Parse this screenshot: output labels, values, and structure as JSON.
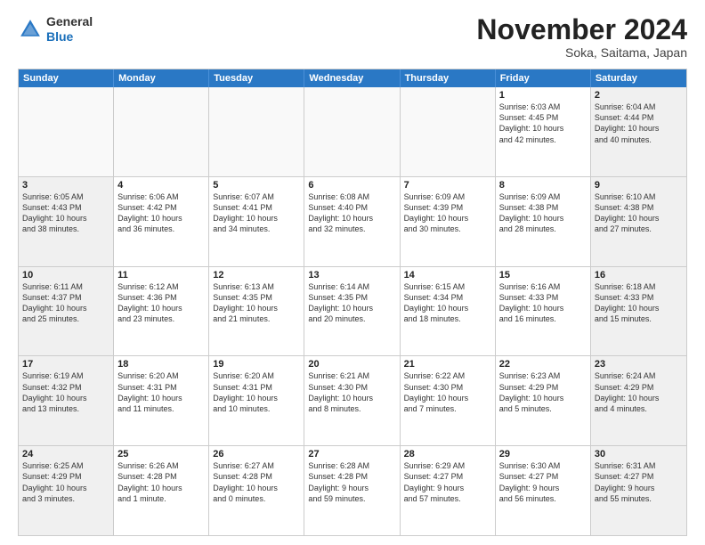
{
  "header": {
    "logo_general": "General",
    "logo_blue": "Blue",
    "month_title": "November 2024",
    "location": "Soka, Saitama, Japan"
  },
  "weekdays": [
    "Sunday",
    "Monday",
    "Tuesday",
    "Wednesday",
    "Thursday",
    "Friday",
    "Saturday"
  ],
  "rows": [
    [
      {
        "day": "",
        "info": "",
        "empty": true
      },
      {
        "day": "",
        "info": "",
        "empty": true
      },
      {
        "day": "",
        "info": "",
        "empty": true
      },
      {
        "day": "",
        "info": "",
        "empty": true
      },
      {
        "day": "",
        "info": "",
        "empty": true
      },
      {
        "day": "1",
        "info": "Sunrise: 6:03 AM\nSunset: 4:45 PM\nDaylight: 10 hours\nand 42 minutes.",
        "empty": false
      },
      {
        "day": "2",
        "info": "Sunrise: 6:04 AM\nSunset: 4:44 PM\nDaylight: 10 hours\nand 40 minutes.",
        "empty": false
      }
    ],
    [
      {
        "day": "3",
        "info": "Sunrise: 6:05 AM\nSunset: 4:43 PM\nDaylight: 10 hours\nand 38 minutes.",
        "empty": false
      },
      {
        "day": "4",
        "info": "Sunrise: 6:06 AM\nSunset: 4:42 PM\nDaylight: 10 hours\nand 36 minutes.",
        "empty": false
      },
      {
        "day": "5",
        "info": "Sunrise: 6:07 AM\nSunset: 4:41 PM\nDaylight: 10 hours\nand 34 minutes.",
        "empty": false
      },
      {
        "day": "6",
        "info": "Sunrise: 6:08 AM\nSunset: 4:40 PM\nDaylight: 10 hours\nand 32 minutes.",
        "empty": false
      },
      {
        "day": "7",
        "info": "Sunrise: 6:09 AM\nSunset: 4:39 PM\nDaylight: 10 hours\nand 30 minutes.",
        "empty": false
      },
      {
        "day": "8",
        "info": "Sunrise: 6:09 AM\nSunset: 4:38 PM\nDaylight: 10 hours\nand 28 minutes.",
        "empty": false
      },
      {
        "day": "9",
        "info": "Sunrise: 6:10 AM\nSunset: 4:38 PM\nDaylight: 10 hours\nand 27 minutes.",
        "empty": false
      }
    ],
    [
      {
        "day": "10",
        "info": "Sunrise: 6:11 AM\nSunset: 4:37 PM\nDaylight: 10 hours\nand 25 minutes.",
        "empty": false
      },
      {
        "day": "11",
        "info": "Sunrise: 6:12 AM\nSunset: 4:36 PM\nDaylight: 10 hours\nand 23 minutes.",
        "empty": false
      },
      {
        "day": "12",
        "info": "Sunrise: 6:13 AM\nSunset: 4:35 PM\nDaylight: 10 hours\nand 21 minutes.",
        "empty": false
      },
      {
        "day": "13",
        "info": "Sunrise: 6:14 AM\nSunset: 4:35 PM\nDaylight: 10 hours\nand 20 minutes.",
        "empty": false
      },
      {
        "day": "14",
        "info": "Sunrise: 6:15 AM\nSunset: 4:34 PM\nDaylight: 10 hours\nand 18 minutes.",
        "empty": false
      },
      {
        "day": "15",
        "info": "Sunrise: 6:16 AM\nSunset: 4:33 PM\nDaylight: 10 hours\nand 16 minutes.",
        "empty": false
      },
      {
        "day": "16",
        "info": "Sunrise: 6:18 AM\nSunset: 4:33 PM\nDaylight: 10 hours\nand 15 minutes.",
        "empty": false
      }
    ],
    [
      {
        "day": "17",
        "info": "Sunrise: 6:19 AM\nSunset: 4:32 PM\nDaylight: 10 hours\nand 13 minutes.",
        "empty": false
      },
      {
        "day": "18",
        "info": "Sunrise: 6:20 AM\nSunset: 4:31 PM\nDaylight: 10 hours\nand 11 minutes.",
        "empty": false
      },
      {
        "day": "19",
        "info": "Sunrise: 6:20 AM\nSunset: 4:31 PM\nDaylight: 10 hours\nand 10 minutes.",
        "empty": false
      },
      {
        "day": "20",
        "info": "Sunrise: 6:21 AM\nSunset: 4:30 PM\nDaylight: 10 hours\nand 8 minutes.",
        "empty": false
      },
      {
        "day": "21",
        "info": "Sunrise: 6:22 AM\nSunset: 4:30 PM\nDaylight: 10 hours\nand 7 minutes.",
        "empty": false
      },
      {
        "day": "22",
        "info": "Sunrise: 6:23 AM\nSunset: 4:29 PM\nDaylight: 10 hours\nand 5 minutes.",
        "empty": false
      },
      {
        "day": "23",
        "info": "Sunrise: 6:24 AM\nSunset: 4:29 PM\nDaylight: 10 hours\nand 4 minutes.",
        "empty": false
      }
    ],
    [
      {
        "day": "24",
        "info": "Sunrise: 6:25 AM\nSunset: 4:29 PM\nDaylight: 10 hours\nand 3 minutes.",
        "empty": false
      },
      {
        "day": "25",
        "info": "Sunrise: 6:26 AM\nSunset: 4:28 PM\nDaylight: 10 hours\nand 1 minute.",
        "empty": false
      },
      {
        "day": "26",
        "info": "Sunrise: 6:27 AM\nSunset: 4:28 PM\nDaylight: 10 hours\nand 0 minutes.",
        "empty": false
      },
      {
        "day": "27",
        "info": "Sunrise: 6:28 AM\nSunset: 4:28 PM\nDaylight: 9 hours\nand 59 minutes.",
        "empty": false
      },
      {
        "day": "28",
        "info": "Sunrise: 6:29 AM\nSunset: 4:27 PM\nDaylight: 9 hours\nand 57 minutes.",
        "empty": false
      },
      {
        "day": "29",
        "info": "Sunrise: 6:30 AM\nSunset: 4:27 PM\nDaylight: 9 hours\nand 56 minutes.",
        "empty": false
      },
      {
        "day": "30",
        "info": "Sunrise: 6:31 AM\nSunset: 4:27 PM\nDaylight: 9 hours\nand 55 minutes.",
        "empty": false
      }
    ]
  ]
}
